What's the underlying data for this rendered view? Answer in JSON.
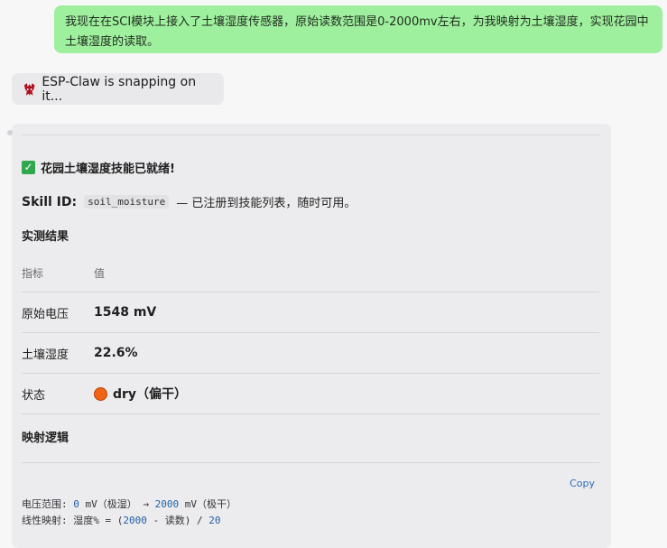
{
  "user_message": "我现在在SCI模块上接入了土壤湿度传感器，原始读数范围是0-2000mv左右，为我映射为土壤湿度，实现花园中土壤湿度的读取。",
  "status": {
    "icon": "claw-icon",
    "text": "ESP-Claw is snapping on it..."
  },
  "reply": {
    "ready_icon": "check-icon",
    "ready_text": "花园土壤湿度技能已就绪!",
    "skill_id_label": "Skill ID:",
    "skill_id_value": "soil_moisture",
    "skill_id_suffix": "— 已注册到技能列表，随时可用。",
    "results_heading": "实测结果",
    "table": {
      "headers": [
        "指标",
        "值"
      ],
      "rows": [
        {
          "metric": "原始电压",
          "value": "1548 mV"
        },
        {
          "metric": "土壤湿度",
          "value": "22.6%"
        },
        {
          "metric": "状态",
          "value": "dry（偏干）",
          "status_color": "#f06414"
        }
      ]
    },
    "mapping_heading": "映射逻辑",
    "code": {
      "copy_label": "Copy",
      "line1": {
        "a": "电压范围: ",
        "n1": "0",
        "b": " mV（极湿） → ",
        "n2": "2000",
        "c": " mV（极干）"
      },
      "line2": {
        "a": "线性映射: 湿度% = (",
        "n1": "2000",
        "b": " - 读数) / ",
        "n2": "20"
      }
    }
  },
  "colors": {
    "user_bubble": "#9ff09e",
    "card_bg": "#ececee",
    "code_number": "#1f5fa8",
    "copy_link": "#2c6bb3"
  }
}
